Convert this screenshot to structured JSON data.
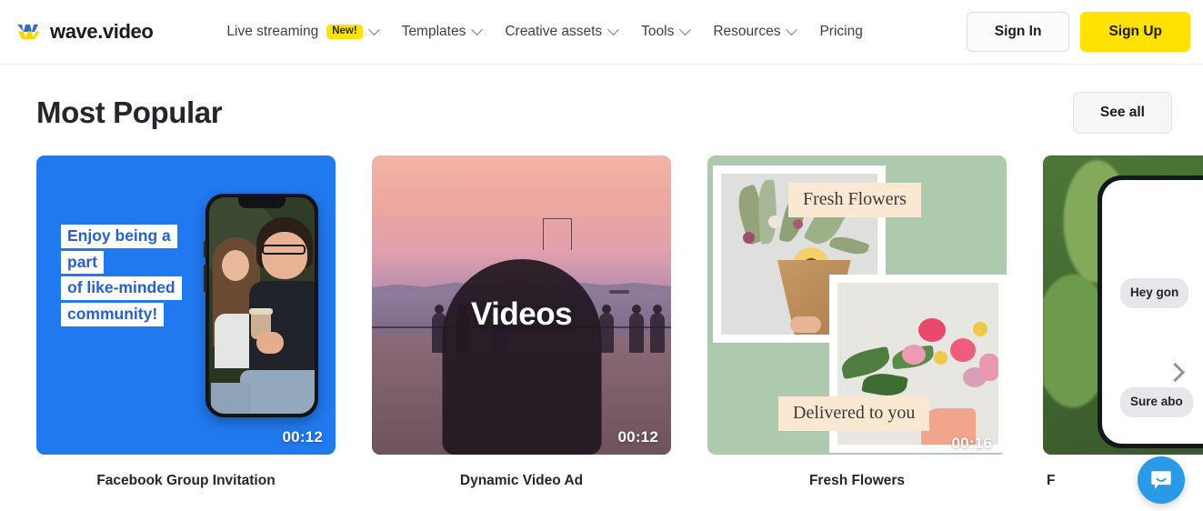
{
  "brand": {
    "name": "wave.video",
    "logo_icon": "wave-logo-icon",
    "logo_colors": {
      "top": "#2b6fd4",
      "bottom": "#ffd500"
    }
  },
  "header": {
    "nav": [
      {
        "label": "Live streaming",
        "badge": "New!",
        "has_dropdown": true
      },
      {
        "label": "Templates",
        "badge": null,
        "has_dropdown": true
      },
      {
        "label": "Creative assets",
        "badge": null,
        "has_dropdown": true
      },
      {
        "label": "Tools",
        "badge": null,
        "has_dropdown": true
      },
      {
        "label": "Resources",
        "badge": null,
        "has_dropdown": true
      },
      {
        "label": "Pricing",
        "badge": null,
        "has_dropdown": false
      }
    ],
    "sign_in": "Sign In",
    "sign_up": "Sign Up",
    "accent_yellow": "#ffe200"
  },
  "section": {
    "title": "Most Popular",
    "see_all": "See all",
    "next_arrow_icon": "chevron-right-icon"
  },
  "cards": [
    {
      "title": "Facebook Group Invitation",
      "duration": "00:12",
      "bg_color": "#2179ef",
      "text_color": "#2562cb",
      "lines": [
        "Enjoy being a",
        "part",
        "of like-minded",
        "community!"
      ]
    },
    {
      "title": "Dynamic Video Ad",
      "duration": "00:12",
      "overlay_text": "Videos",
      "bg_color": "#b98ead"
    },
    {
      "title": "Fresh Flowers",
      "duration": "00:16",
      "bg_color": "#adc9ae",
      "banner_color": "#fae8d2",
      "banner_top": "Fresh Flowers",
      "banner_bottom": "Delivered to you"
    },
    {
      "title": "F",
      "duration": "",
      "bg_color": "#3f6430",
      "chat": [
        "Hey\ngon",
        "Sure\nabo"
      ]
    }
  ],
  "intercom": {
    "icon": "chat-bubble-icon",
    "color": "#2a9ae8"
  }
}
